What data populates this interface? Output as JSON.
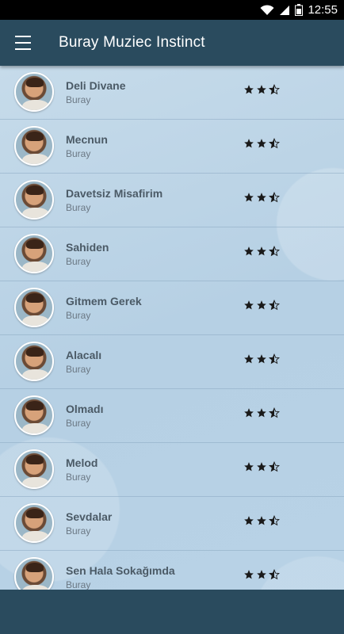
{
  "status": {
    "time": "12:55"
  },
  "appbar": {
    "title": "Buray Muziec Instinct"
  },
  "songs": [
    {
      "title": "Deli Divane",
      "artist": "Buray",
      "rating": 2.5
    },
    {
      "title": "Mecnun",
      "artist": "Buray",
      "rating": 2.5
    },
    {
      "title": "Davetsiz Misafirim",
      "artist": "Buray",
      "rating": 2.5
    },
    {
      "title": "Sahiden",
      "artist": "Buray",
      "rating": 2.5
    },
    {
      "title": "Gitmem Gerek",
      "artist": "Buray",
      "rating": 2.5
    },
    {
      "title": "Alacalı",
      "artist": "Buray",
      "rating": 2.5
    },
    {
      "title": "Olmadı",
      "artist": "Buray",
      "rating": 2.5
    },
    {
      "title": "Melod",
      "artist": "Buray",
      "rating": 2.5
    },
    {
      "title": "Sevdalar",
      "artist": "Buray",
      "rating": 2.5
    },
    {
      "title": "Sen Hala Sokağımda",
      "artist": "Buray",
      "rating": 2.5
    }
  ],
  "icons": {
    "wifi": "wifi-icon",
    "signal": "signal-icon",
    "battery": "battery-icon",
    "menu": "hamburger-menu-icon",
    "star": "star-icon"
  },
  "colors": {
    "appbar": "#2a4b5e",
    "statusbar": "#000000",
    "title_text": "#4b5a66"
  }
}
